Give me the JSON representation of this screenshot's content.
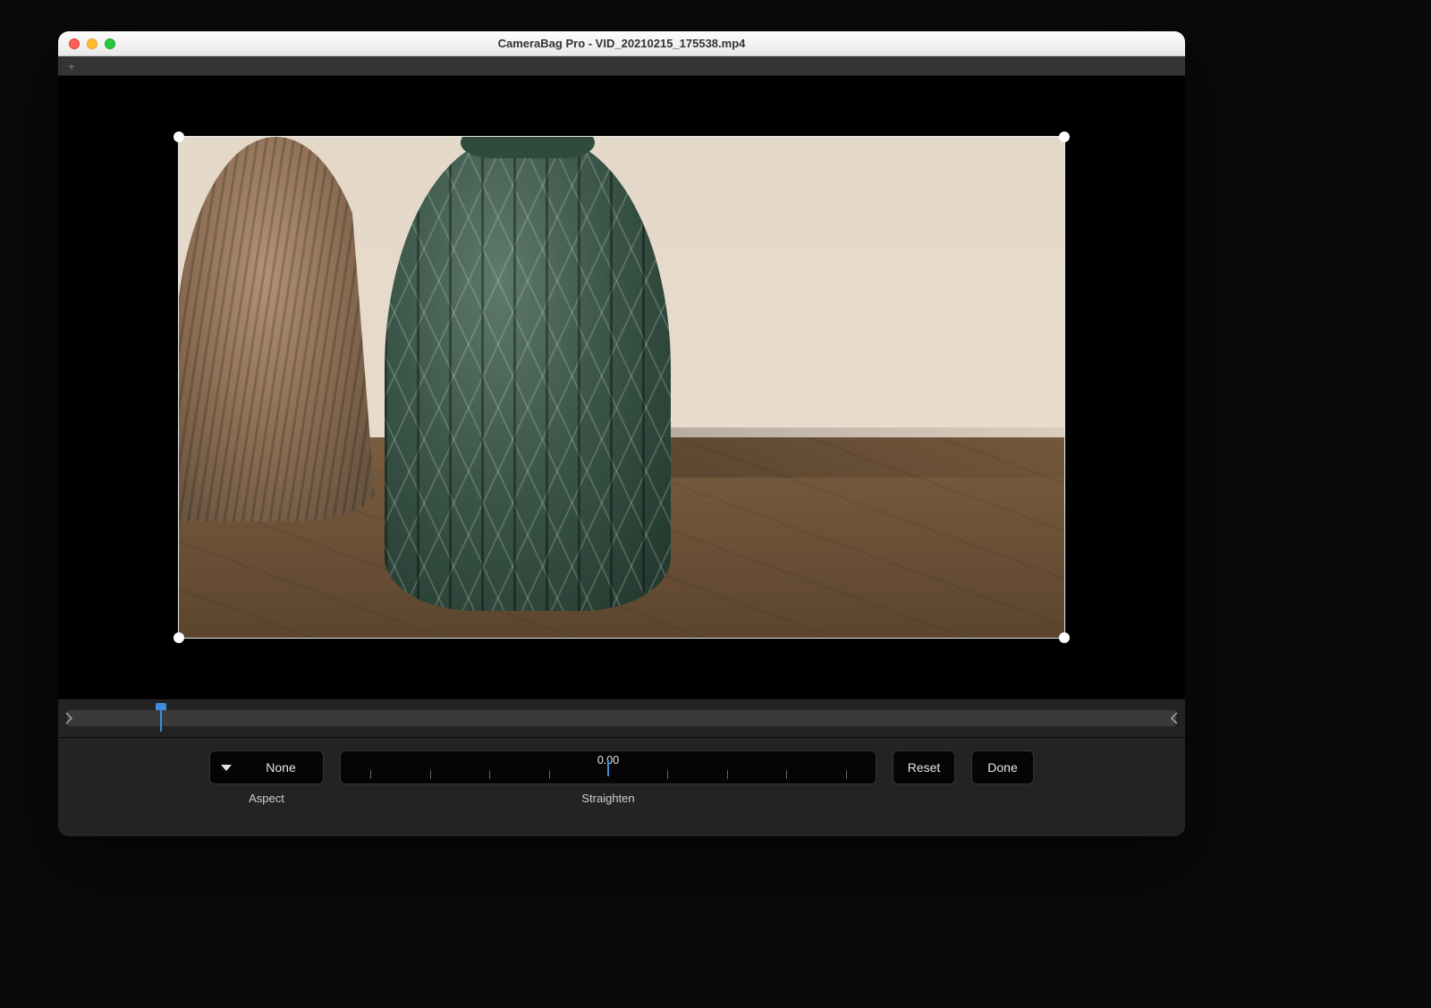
{
  "window": {
    "title": "CameraBag Pro - VID_20210215_175538.mp4"
  },
  "timeline": {
    "playhead_position_pct": 8
  },
  "controls": {
    "aspect": {
      "label": "Aspect",
      "selected": "None"
    },
    "straighten": {
      "label": "Straighten",
      "value": "0.00"
    },
    "reset_label": "Reset",
    "done_label": "Done"
  },
  "icons": {
    "add_tab": "plus-icon",
    "dropdown_caret": "chevron-down-icon",
    "timeline_trim_start": "chevron-right-icon",
    "timeline_trim_end": "chevron-left-icon"
  }
}
